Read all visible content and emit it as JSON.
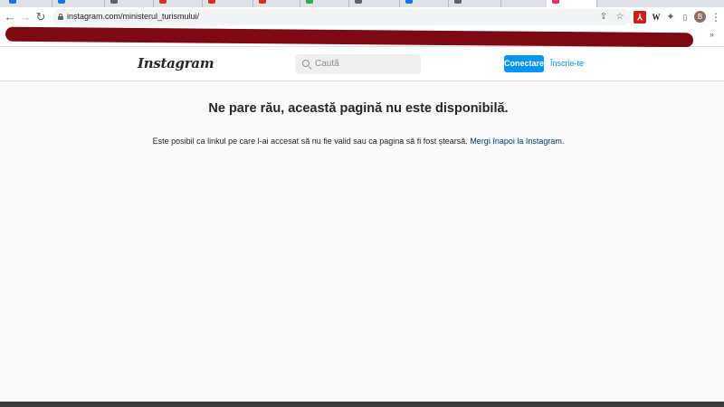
{
  "browser": {
    "tabs": [
      {
        "favicon_color": "#1a73e8"
      },
      {
        "favicon_color": "#1a73e8"
      },
      {
        "favicon_color": "#5f6368"
      },
      {
        "favicon_color": "#d93025"
      },
      {
        "favicon_color": "#d93025"
      },
      {
        "favicon_color": "#d93025"
      },
      {
        "favicon_color": "#34a853"
      },
      {
        "favicon_color": "#5f6368"
      },
      {
        "favicon_color": "#1a73e8"
      },
      {
        "favicon_color": "#5f6368"
      },
      {
        "favicon_color": "#e1306c",
        "active": true
      }
    ],
    "url": "instagram.com/ministerul_turismului/",
    "avatar_letter": "B",
    "extensions": {
      "pdf": "⅄",
      "w": "W",
      "puzzle": "✦",
      "panel": "▯"
    },
    "bookmarks_more": "»",
    "redaction_color": "#7d0a12"
  },
  "instagram": {
    "logo": "Instagram",
    "search_placeholder": "Caută",
    "login_label": "Conectare",
    "signup_label": "Înscrie-te"
  },
  "error": {
    "title": "Ne pare rău, această pagină nu este disponibilă.",
    "message": "Este posibil ca linkul pe care l-ai accesat să nu fie valid sau ca pagina să fi fost ștearsă.",
    "back_link": "Mergi înapoi la Instagram."
  },
  "colors": {
    "accent": "#0095f6",
    "link_dark": "#00376b",
    "background": "#fafafa"
  }
}
